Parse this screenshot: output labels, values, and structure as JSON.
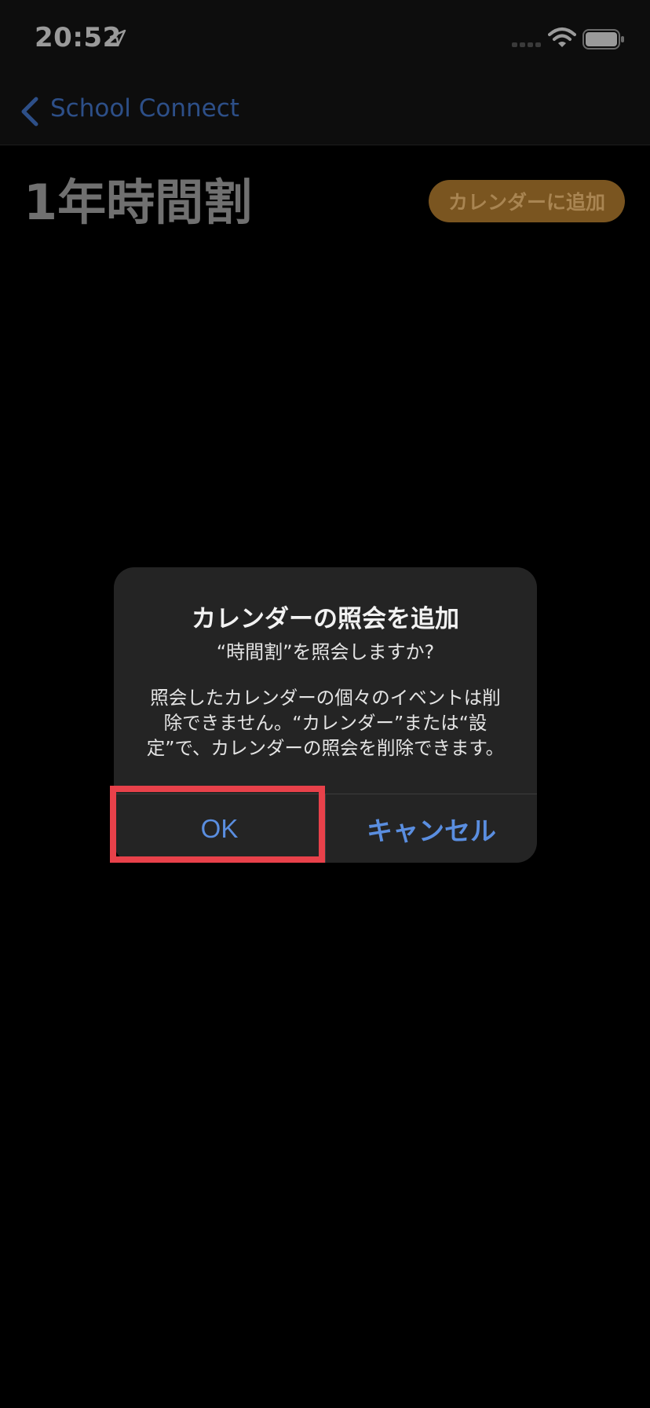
{
  "status_bar": {
    "time": "20:52",
    "icons": [
      "location-arrow-icon",
      "cell-signal-icon",
      "wifi-icon",
      "battery-icon"
    ]
  },
  "nav": {
    "back_label": "School Connect",
    "back_icon": "chevron-left-icon"
  },
  "page": {
    "title": "1年時間割",
    "add_calendar_button": "カレンダーに追加"
  },
  "alert": {
    "title": "カレンダーの照会を追加",
    "subtitle": "“時間割”を照会しますか?",
    "message_lines": [
      "照会したカレンダーの個々のイベントは削",
      "除できません。“カレンダー”または“設",
      "定”で、カレンダーの照会を削除できます。"
    ],
    "ok_label": "OK",
    "cancel_label": "キャンセル"
  },
  "colors": {
    "accent_blue": "#5a8ee0",
    "orange_button": "#7a5520",
    "highlight_red": "#e8414a",
    "dialog_bg": "#242424",
    "background": "#000000"
  }
}
